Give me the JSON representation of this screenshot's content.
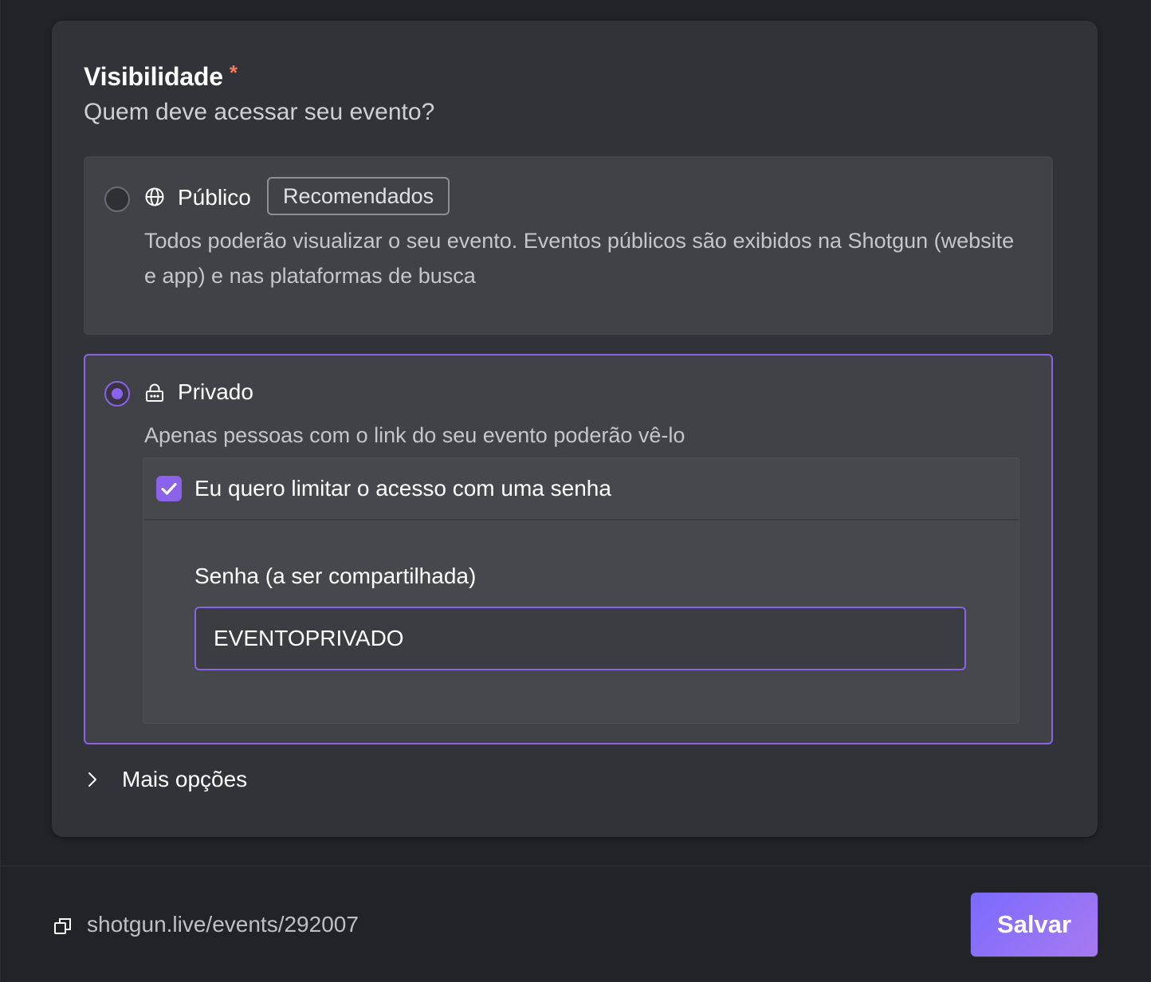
{
  "section": {
    "title": "Visibilidade",
    "required_mark": "*",
    "subtitle": "Quem deve acessar seu evento?"
  },
  "options": {
    "public": {
      "label": "Público",
      "badge": "Recomendados",
      "icon": "globe-icon",
      "description": "Todos poderão visualizar o seu evento. Eventos públicos são exibidos na Shotgun (website e app) e nas plataformas de busca",
      "selected": false
    },
    "private": {
      "label": "Privado",
      "icon": "lock-icon",
      "description": "Apenas pessoas com o link do seu evento poderão vê-lo",
      "selected": true,
      "password_checkbox": {
        "label": "Eu quero limitar o acesso com uma senha",
        "checked": true
      },
      "password_field": {
        "label": "Senha (a ser compartilhada)",
        "value": "EVENTOPRIVADO"
      }
    }
  },
  "more_options": {
    "label": "Mais opções",
    "icon": "chevron-right-icon"
  },
  "footer": {
    "link_icon": "copy-icon",
    "event_link": "shotgun.live/events/292007",
    "save_label": "Salvar"
  },
  "colors": {
    "accent": "#8a63e8",
    "required": "#f07c5c",
    "card_bg": "#323338",
    "page_bg": "#222327"
  }
}
